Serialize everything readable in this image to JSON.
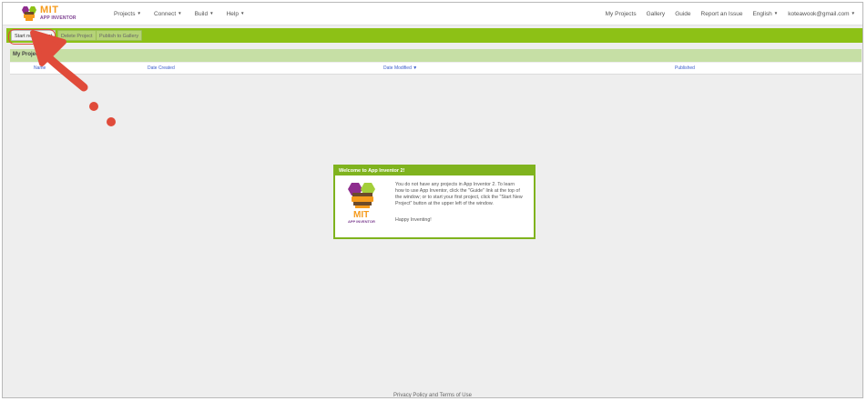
{
  "logo": {
    "mit": "MIT",
    "app_inventor": "APP INVENTOR"
  },
  "nav_left": [
    {
      "label": "Projects"
    },
    {
      "label": "Connect"
    },
    {
      "label": "Build"
    },
    {
      "label": "Help"
    }
  ],
  "nav_right": {
    "my_projects": "My Projects",
    "gallery": "Gallery",
    "guide": "Guide",
    "report": "Report an Issue",
    "language": "English",
    "account": "koteawook@gmail.com"
  },
  "toolbar": {
    "start_new": "Start new project",
    "delete": "Delete Project",
    "publish": "Publish to Gallery"
  },
  "projects": {
    "title": "My Projects",
    "columns": {
      "name": "Name",
      "created": "Date Created",
      "modified": "Date Modified ▼",
      "published": "Published"
    }
  },
  "dialog": {
    "title": "Welcome to App Inventor 2!",
    "logo_mit": "MIT",
    "logo_ai": "APP INVENTOR",
    "message": "You do not have any projects in App Inventor 2. To learn how to use App Inventor, click the \"Guide\" link at the top of the window; or to start your first project, click the \"Start New Project\" button at the upper left of the window.",
    "happy": "Happy Inventing!"
  },
  "footer": {
    "link": "Privacy Policy and Terms of Use"
  },
  "colors": {
    "toolbar_green": "#8dc116",
    "header_green": "#c6dfa5",
    "dialog_green": "#7fb31e",
    "annotation_red": "#e04b3a"
  }
}
